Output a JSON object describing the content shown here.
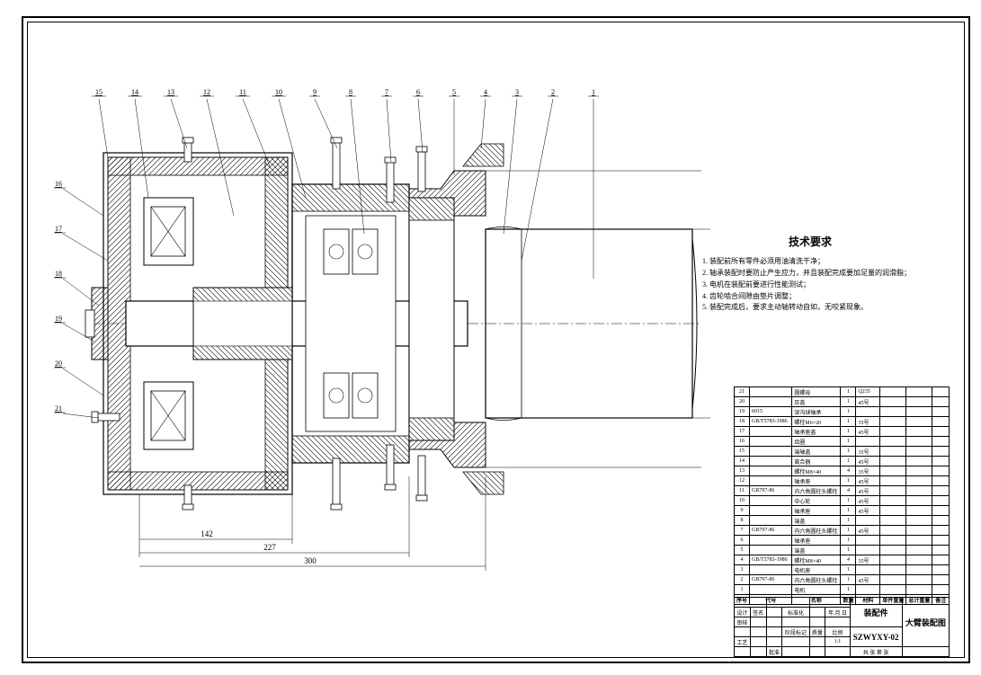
{
  "tech": {
    "title": "技术要求",
    "items": [
      "1. 装配前所有零件必须用油清洗干净；",
      "2. 轴承装配时要防止产生应力，并且装配完成要加足量的润滑脂；",
      "3. 电机在装配前要进行性能测试；",
      "4. 齿轮啮合间隙由垫片调整；",
      "5. 装配完成后，要求主动轴转动自如，无咬紧现象。"
    ]
  },
  "bom_header": {
    "num": "序号",
    "code": "代号",
    "name": "名称",
    "qty": "数量",
    "mat": "材料",
    "wt1": "单件重量",
    "wt2": "总计重量",
    "note": "备注"
  },
  "bom": [
    {
      "n": "21",
      "code": "",
      "name": "圆螺母",
      "q": "1",
      "m": "Q235",
      "w1": "",
      "w2": "",
      "note": ""
    },
    {
      "n": "20",
      "code": "",
      "name": "压盖",
      "q": "1",
      "m": "45号",
      "w1": "",
      "w2": "",
      "note": ""
    },
    {
      "n": "19",
      "code": "6015",
      "name": "深沟球轴承",
      "q": "1",
      "m": "",
      "w1": "",
      "w2": "",
      "note": ""
    },
    {
      "n": "18",
      "code": "GB/T5783-1986",
      "name": "螺栓M6×20",
      "q": "1",
      "m": "35号",
      "w1": "",
      "w2": "",
      "note": ""
    },
    {
      "n": "17",
      "code": "",
      "name": "轴承座盖",
      "q": "1",
      "m": "45号",
      "w1": "",
      "w2": "",
      "note": ""
    },
    {
      "n": "16",
      "code": "",
      "name": "齿圈",
      "q": "1",
      "m": "",
      "w1": "",
      "w2": "",
      "note": ""
    },
    {
      "n": "15",
      "code": "",
      "name": "端轴盖",
      "q": "1",
      "m": "35号",
      "w1": "",
      "w2": "",
      "note": ""
    },
    {
      "n": "14",
      "code": "",
      "name": "离合器",
      "q": "1",
      "m": "45号",
      "w1": "",
      "w2": "",
      "note": ""
    },
    {
      "n": "13",
      "code": "",
      "name": "螺栓M8×40",
      "q": "4",
      "m": "35号",
      "w1": "",
      "w2": "",
      "note": ""
    },
    {
      "n": "12",
      "code": "",
      "name": "轴承座",
      "q": "1",
      "m": "45号",
      "w1": "",
      "w2": "",
      "note": ""
    },
    {
      "n": "11",
      "code": "GB797-86",
      "name": "内六角圆柱头螺栓",
      "q": "4",
      "m": "45号",
      "w1": "",
      "w2": "",
      "note": ""
    },
    {
      "n": "10",
      "code": "",
      "name": "中心轮",
      "q": "1",
      "m": "45号",
      "w1": "",
      "w2": "",
      "note": ""
    },
    {
      "n": "9",
      "code": "",
      "name": "轴承座",
      "q": "1",
      "m": "45号",
      "w1": "",
      "w2": "",
      "note": ""
    },
    {
      "n": "8",
      "code": "",
      "name": "端盖",
      "q": "1",
      "m": "",
      "w1": "",
      "w2": "",
      "note": ""
    },
    {
      "n": "7",
      "code": "GB797-86",
      "name": "内六角圆柱头螺栓",
      "q": "1",
      "m": "45号",
      "w1": "",
      "w2": "",
      "note": ""
    },
    {
      "n": "6",
      "code": "",
      "name": "轴承座",
      "q": "1",
      "m": "",
      "w1": "",
      "w2": "",
      "note": ""
    },
    {
      "n": "5",
      "code": "",
      "name": "端盖",
      "q": "1",
      "m": "",
      "w1": "",
      "w2": "",
      "note": ""
    },
    {
      "n": "4",
      "code": "GB/T5783-1986",
      "name": "螺栓M8×40",
      "q": "4",
      "m": "35号",
      "w1": "",
      "w2": "",
      "note": ""
    },
    {
      "n": "3",
      "code": "",
      "name": "电机座",
      "q": "1",
      "m": "",
      "w1": "",
      "w2": "",
      "note": ""
    },
    {
      "n": "2",
      "code": "GB797-86",
      "name": "内六角圆柱头螺栓",
      "q": "1",
      "m": "45号",
      "w1": "",
      "w2": "",
      "note": ""
    },
    {
      "n": "1",
      "code": "",
      "name": "电机",
      "q": "1",
      "m": "",
      "w1": "",
      "w2": "",
      "note": ""
    }
  ],
  "title_block": {
    "part_type": "装配件",
    "drawing_name": "大臂装配图",
    "drawing_no": "SZWYXY-02",
    "scale_label": "比例",
    "scale": "1:1",
    "mass_label": "质量",
    "stage_label": "阶段标记",
    "sheet_label": "共 张 第 张",
    "design": "设计",
    "check": "审核",
    "proc": "工艺",
    "std": "标准化",
    "appr": "批准",
    "sig": "签名",
    "date": "年.月.日"
  },
  "callout_numbers": [
    "15",
    "14",
    "13",
    "12",
    "11",
    "10",
    "9",
    "8",
    "7",
    "6",
    "5",
    "4",
    "3",
    "2",
    "1",
    "16",
    "17",
    "18",
    "19",
    "20",
    "21"
  ],
  "dims": {
    "d1": "142",
    "d2": "227",
    "d3": "300"
  }
}
